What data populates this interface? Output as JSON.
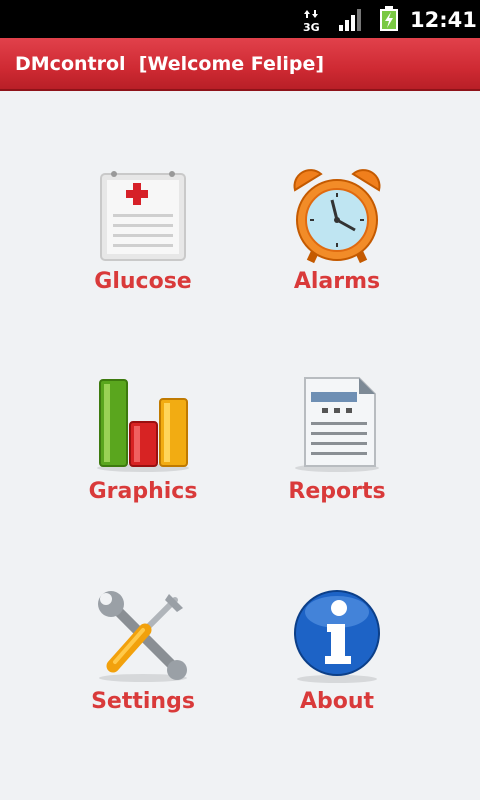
{
  "status_bar": {
    "network": "3G",
    "time": "12:41",
    "icons": [
      "data-transfer-icon",
      "signal-strength-icon",
      "battery-charging-icon"
    ]
  },
  "app_bar": {
    "title": "DMcontrol  [Welcome Felipe]",
    "color": "#d1323a"
  },
  "menu": {
    "label_color": "#d93a3a",
    "items": [
      {
        "label": "Glucose",
        "icon": "medical-record-icon"
      },
      {
        "label": "Alarms",
        "icon": "alarm-clock-icon"
      },
      {
        "label": "Graphics",
        "icon": "bar-chart-icon"
      },
      {
        "label": "Reports",
        "icon": "document-icon"
      },
      {
        "label": "Settings",
        "icon": "tools-icon"
      },
      {
        "label": "About",
        "icon": "info-icon"
      }
    ]
  }
}
